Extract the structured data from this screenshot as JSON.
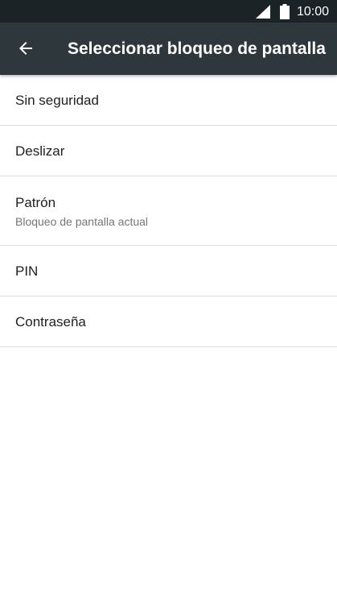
{
  "status_bar": {
    "time": "10:00",
    "signal_icon": "cell-signal-icon",
    "battery_icon": "battery-icon"
  },
  "toolbar": {
    "back_icon": "arrow-back-icon",
    "title": "Seleccionar bloqueo de pantalla"
  },
  "options": [
    {
      "label": "Sin seguridad"
    },
    {
      "label": "Deslizar"
    },
    {
      "label": "Patrón",
      "subtitle": "Bloqueo de pantalla actual"
    },
    {
      "label": "PIN"
    },
    {
      "label": "Contraseña"
    }
  ],
  "colors": {
    "status_bar": "#1c2326",
    "toolbar": "#2e383c",
    "background": "#ffffff",
    "divider": "#dcdcdc",
    "primary_text": "#212121",
    "secondary_text": "#757575"
  }
}
